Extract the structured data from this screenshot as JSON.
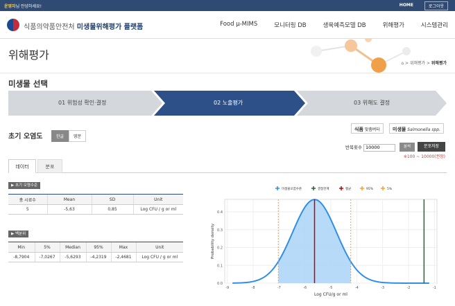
{
  "topbar": {
    "greeting_user": "운영자",
    "greeting_rest": "님 안녕하세요!",
    "home": "HOME",
    "logout": "로그아웃"
  },
  "header": {
    "org": "식품의약품안전처",
    "platform": "미생물위해평가 플랫폼",
    "nav": [
      "Food μ-MIMS",
      "모니터링 DB",
      "생육예측모델 DB",
      "위해평가",
      "시스템관리"
    ]
  },
  "page": {
    "title": "위해평가",
    "breadcrumb_parent": "위해평가",
    "breadcrumb_current": "위해평가"
  },
  "section": {
    "title": "미생물 선택"
  },
  "steps": [
    "01 위험성 확인·결정",
    "02 노출평가",
    "03 위해도 결정"
  ],
  "initial": {
    "title": "초기 오염도",
    "lang_ko": "한글",
    "lang_en": "영문"
  },
  "tags": {
    "food_label": "식품",
    "food_value": "맞춤버터",
    "micro_label": "미생물",
    "micro_value": "Salmonella spp."
  },
  "iteration": {
    "label": "반복횟수",
    "value": "10000",
    "analyze": "분석",
    "save": "분포저장",
    "hint": "※100 ~ 10000(권장)"
  },
  "tabs": [
    "데이터",
    "분포"
  ],
  "table1": {
    "title": "초기 오염수준",
    "headers": [
      "총 시료수",
      "Mean",
      "SD",
      "Unit"
    ],
    "row": [
      "5",
      "-5,63",
      "0,85",
      "Log CFU / g or ml"
    ]
  },
  "table2": {
    "title": "백분위",
    "headers": [
      "Min",
      "5%",
      "Median",
      "95%",
      "Max",
      "Unit"
    ],
    "row": [
      "-8,7904",
      "-7,0267",
      "-5,6293",
      "-4,2319",
      "-2,4681",
      "Log CFU / g or ml"
    ]
  },
  "chart_data": {
    "type": "area",
    "xlabel": "Log CFU/g or ml",
    "ylabel": "Probability density",
    "xlim": [
      -9.1,
      -0.9
    ],
    "ylim": [
      0,
      0.47
    ],
    "xticks": [
      -9,
      -8,
      -7,
      -6,
      -5,
      -4,
      -3,
      -2,
      -1
    ],
    "yticks": [
      0.0,
      0.1,
      0.2,
      0.3,
      0.4
    ],
    "distribution": {
      "mean": -5.63,
      "sd": 0.85,
      "x_start": -8.8,
      "x_end": -1.2
    },
    "legend": [
      "미생물오염수준",
      "결정한계",
      "평균",
      "95%",
      "5%"
    ],
    "markers": [
      {
        "name": "평균",
        "x": -5.63,
        "color": "#c00000"
      },
      {
        "name": "95%",
        "x": -4.23,
        "color": "#f4a12a"
      },
      {
        "name": "5%",
        "x": -7.03,
        "color": "#f4a12a"
      },
      {
        "name": "결정한계",
        "x": -1.4,
        "color": "#1e6b2a"
      }
    ],
    "colors": {
      "curve": "#2f8fe8",
      "fill": "#a9d3f7"
    }
  }
}
